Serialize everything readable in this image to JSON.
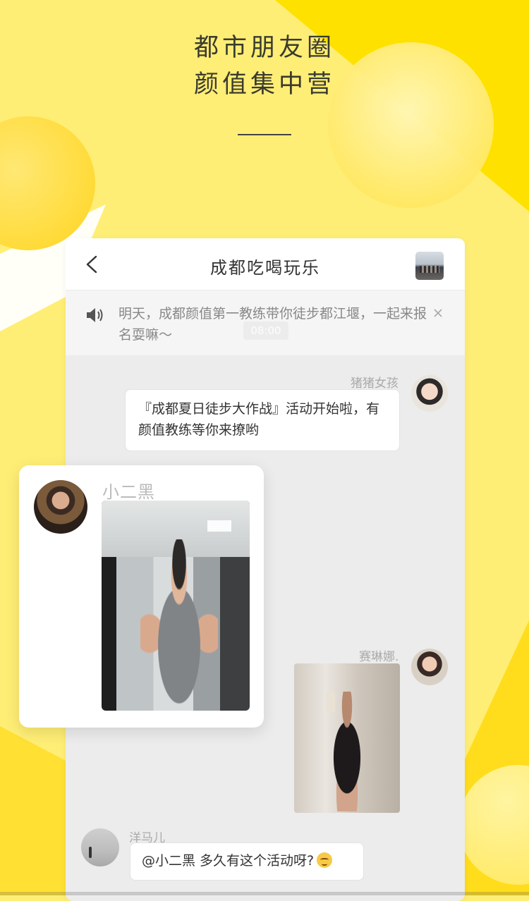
{
  "headline": {
    "line1": "都市朋友圈",
    "line2": "颜值集中营"
  },
  "chat": {
    "title": "成都吃喝玩乐",
    "notice": {
      "text": "明天，成都颜值第一教练带你徒步都江堰，一起来报名耍嘛～",
      "time": "08:00"
    },
    "messages": [
      {
        "nickname": "猪猪女孩",
        "text": "『成都夏日徒步大作战』活动开始啦，有颜值教练等你来撩哟"
      },
      {
        "nickname": "赛琳娜."
      },
      {
        "nickname": "洋马儿",
        "text": "@小二黑 多久有这个活动呀?"
      }
    ]
  },
  "highlight": {
    "nickname": "小二黑"
  },
  "colors": {
    "accent_yellow": "#ffe100",
    "light_yellow": "#ffee75",
    "text_dark": "#333333"
  },
  "icons": [
    "back-icon",
    "speaker-icon",
    "close-icon",
    "emoji-icon"
  ]
}
